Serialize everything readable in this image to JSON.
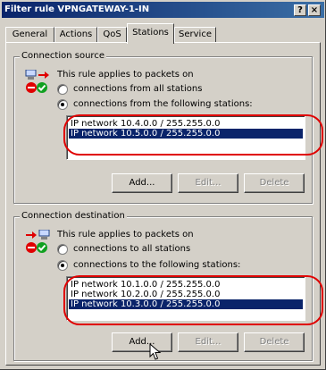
{
  "window": {
    "title": "Filter rule VPNGATEWAY-1-IN",
    "help_label": "?",
    "close_label": "×"
  },
  "tabs": [
    {
      "label": "General"
    },
    {
      "label": "Actions"
    },
    {
      "label": "QoS"
    },
    {
      "label": "Stations",
      "active": true
    },
    {
      "label": "Service"
    }
  ],
  "source": {
    "group_label": "Connection source",
    "applies_text": "This rule applies to packets on",
    "option_all": "connections from all stations",
    "option_following": "connections from the following stations:",
    "selected_option": "following",
    "items": [
      "IP network 10.4.0.0 / 255.255.0.0",
      "IP network 10.5.0.0 / 255.255.0.0"
    ],
    "selected_index": 1,
    "add_label": "Add...",
    "edit_label": "Edit...",
    "delete_label": "Delete"
  },
  "destination": {
    "group_label": "Connection destination",
    "applies_text": "This rule applies to packets on",
    "option_all": "connections to all stations",
    "option_following": "connections to the following stations:",
    "selected_option": "following",
    "items": [
      "IP network 10.1.0.0 / 255.255.0.0",
      "IP network 10.2.0.0 / 255.255.0.0",
      "IP network 10.3.0.0 / 255.255.0.0"
    ],
    "selected_index": 2,
    "add_label": "Add...",
    "edit_label": "Edit...",
    "delete_label": "Delete"
  },
  "colors": {
    "selection": "#0a246a",
    "highlight_ring": "#e00000",
    "face": "#d4d0c8"
  }
}
